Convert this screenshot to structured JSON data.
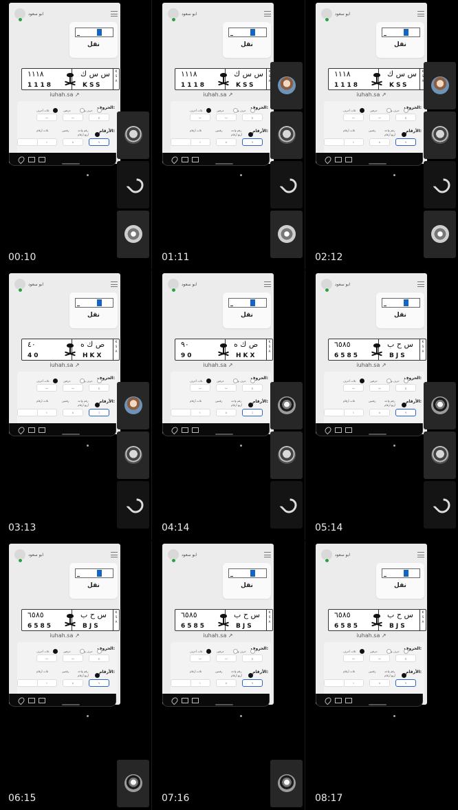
{
  "frames": [
    {
      "time": "00:10",
      "ar_letters": "س س ك",
      "ar_numbers": "١١١٨",
      "lat_letters": "KSS",
      "lat_numbers": "1118",
      "sidebar": [
        "landscape",
        "logo",
        "hand"
      ],
      "selected_chip": "٩"
    },
    {
      "time": "01:11",
      "ar_letters": "س س ك",
      "ar_numbers": "١١١٨",
      "lat_letters": "KSS",
      "lat_numbers": "1118",
      "sidebar": [
        "portrait",
        "landscape",
        "logo",
        "hand"
      ],
      "selected_chip": "٩"
    },
    {
      "time": "02:12",
      "ar_letters": "س س ك",
      "ar_numbers": "١١١٨",
      "lat_letters": "KSS",
      "lat_numbers": "1118",
      "sidebar": [
        "portrait",
        "landscape",
        "logo",
        "hand"
      ],
      "selected_chip": "٩"
    },
    {
      "time": "03:13",
      "ar_letters": "ص ك ه",
      "ar_numbers": "٤٠",
      "lat_letters": "HKX",
      "lat_numbers": "40",
      "sidebar": [
        "portrait",
        "landscape",
        "logo"
      ],
      "selected_chip": "|"
    },
    {
      "time": "04:14",
      "ar_letters": "ص ك ه",
      "ar_numbers": "٩٠",
      "lat_letters": "HKX",
      "lat_numbers": "90",
      "sidebar": [
        "ring",
        "landscape",
        "logo"
      ],
      "selected_chip": "|"
    },
    {
      "time": "05:14",
      "ar_letters": "س ح ب",
      "ar_numbers": "٦٥٨٥",
      "lat_letters": "BJS",
      "lat_numbers": "6585",
      "sidebar": [
        "ring",
        "landscape",
        "logo"
      ],
      "selected_chip": "٩"
    },
    {
      "time": "06:15",
      "ar_letters": "س ح ب",
      "ar_numbers": "٦٥٨٥",
      "lat_letters": "BJS",
      "lat_numbers": "6585",
      "sidebar": [
        "ring"
      ],
      "selected_chip": "٩"
    },
    {
      "time": "07:16",
      "ar_letters": "س ح ب",
      "ar_numbers": "٦٥٨٥",
      "lat_letters": "BJS",
      "lat_numbers": "6585",
      "sidebar": [
        "ring"
      ],
      "selected_chip": "٩"
    },
    {
      "time": "08:17",
      "ar_letters": "س ح ب",
      "ar_numbers": "٦٥٨٥",
      "lat_letters": "BJS",
      "lat_numbers": "6585",
      "sidebar": [],
      "selected_chip": "٩"
    }
  ],
  "common": {
    "user_name": "ابو سعود",
    "transfer_label": "نقل",
    "link_text": "iuhah.sa",
    "letters_label": "الحروف:",
    "numbers_label": "الأرقام:",
    "letter_options": [
      "حرف واحد",
      "حرفين",
      "ثلاث أحرف"
    ],
    "number_options": [
      "رقم واحد",
      "رقمين",
      "ثلاث أرقام",
      "أربع أرقام"
    ],
    "ksa_text": "KSA"
  }
}
